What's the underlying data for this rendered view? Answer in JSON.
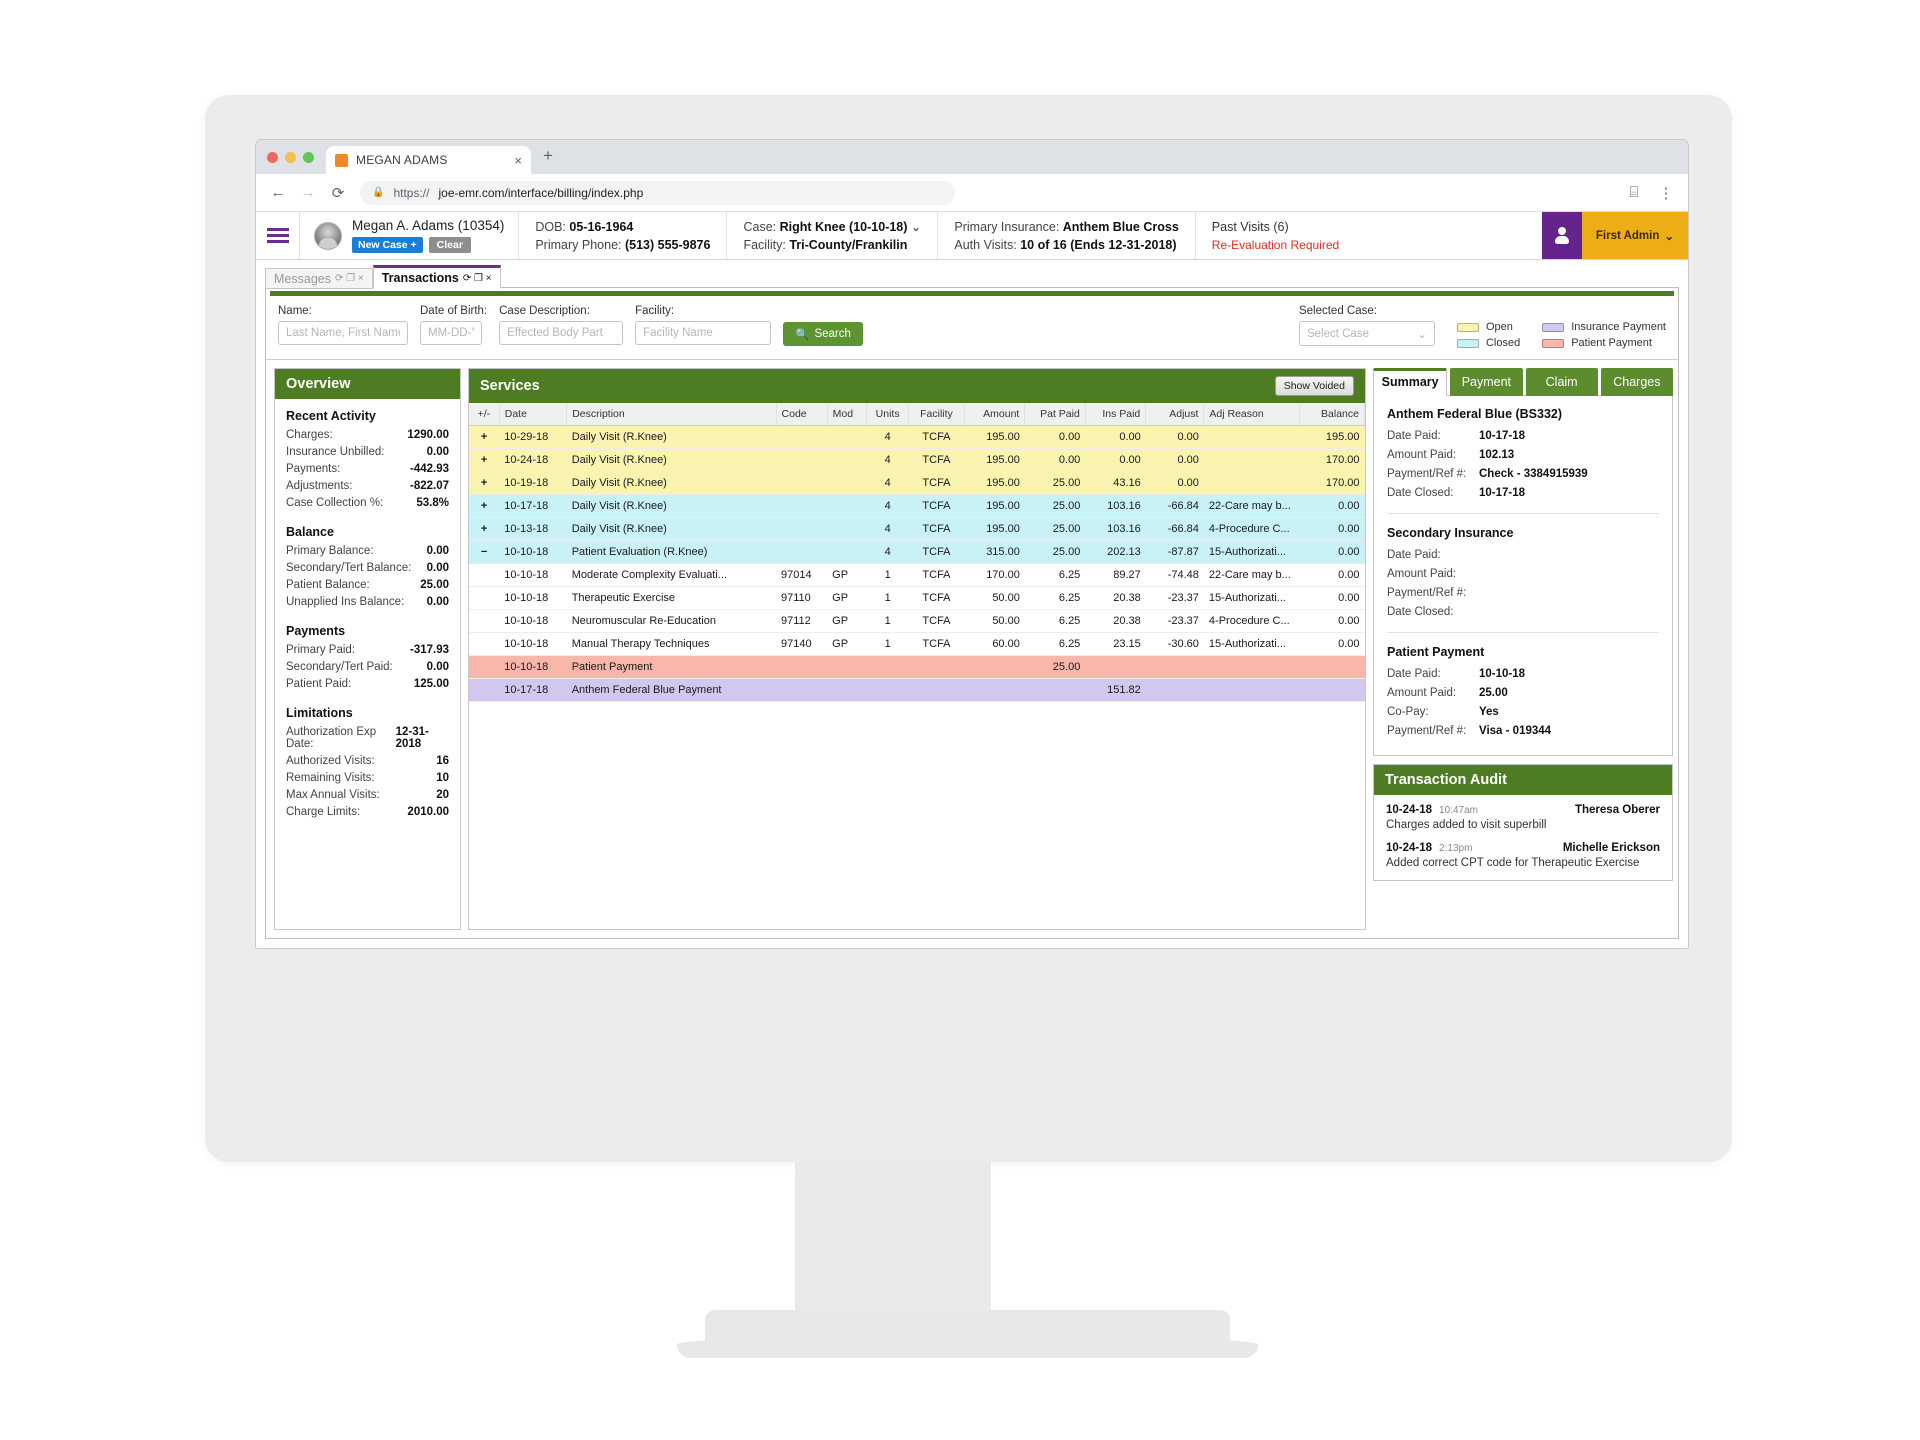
{
  "browser": {
    "tab_title": "MEGAN ADAMS",
    "close_label": "×",
    "newtab_label": "+",
    "back_icon": "←",
    "forward_icon": "→",
    "reload_icon": "⟳",
    "lock_icon": "🔒",
    "url_scheme": "https://",
    "url_rest": "joe-emr.com/interface/billing/index.php",
    "bookmark_icon": "⌸",
    "menu_icon": "⋮"
  },
  "patient_header": {
    "name": "Megan A. Adams (10354)",
    "new_case_label": "New Case +",
    "clear_label": "Clear",
    "dob_label": "DOB:",
    "dob_value": "05-16-1964",
    "phone_label": "Primary Phone:",
    "phone_value": "(513) 555-9876",
    "case_label": "Case:",
    "case_value": "Right Knee (10-10-18)",
    "case_caret": "⌄",
    "facility_label": "Facility:",
    "facility_value": "Tri-County/Frankilin",
    "primary_insurance_label": "Primary Insurance:",
    "primary_insurance_value": "Anthem Blue Cross",
    "auth_visits_label": "Auth Visits:",
    "auth_visits_value": "10 of 16 (Ends 12-31-2018)",
    "past_visits": "Past Visits (6)",
    "reevaluation": "Re-Evaluation Required",
    "admin_label": "First Admin",
    "admin_caret": "⌄",
    "accent_purple": "#65248b",
    "accent_gold": "#edad15"
  },
  "app_tabs": [
    {
      "label": "Messages",
      "active": false,
      "icons": "⟳ ❐ ×"
    },
    {
      "label": "Transactions",
      "active": true,
      "icons": "⟳ ❐ ×"
    }
  ],
  "search": {
    "name_label": "Name:",
    "name_placeholder": "Last Name, First Name",
    "dob_label": "Date of Birth:",
    "dob_placeholder": "MM-DD-YY",
    "case_label": "Case Description:",
    "case_placeholder": "Effected Body Part",
    "facility_label": "Facility:",
    "facility_placeholder": "Facility Name",
    "search_button": "Search",
    "search_icon": "🔍",
    "selected_case_label": "Selected Case:",
    "selected_case_value": "Select Case",
    "selected_case_caret": "⌄"
  },
  "legend": [
    {
      "label": "Open",
      "color": "#fbf3b0"
    },
    {
      "label": "Insurance Payment",
      "color": "#d2c8ef"
    },
    {
      "label": "Closed",
      "color": "#c9f2f7"
    },
    {
      "label": "Patient Payment",
      "color": "#f9b6ab"
    }
  ],
  "overview": {
    "title": "Overview",
    "sections": [
      {
        "heading": "Recent Activity",
        "rows": [
          {
            "k": "Charges:",
            "v": "1290.00"
          },
          {
            "k": "Insurance Unbilled:",
            "v": "0.00"
          },
          {
            "k": "Payments:",
            "v": "-442.93"
          },
          {
            "k": "Adjustments:",
            "v": "-822.07"
          },
          {
            "k": "Case Collection %:",
            "v": "53.8%"
          }
        ]
      },
      {
        "heading": "Balance",
        "rows": [
          {
            "k": "Primary Balance:",
            "v": "0.00"
          },
          {
            "k": "Secondary/Tert Balance:",
            "v": "0.00"
          },
          {
            "k": "Patient Balance:",
            "v": "25.00"
          },
          {
            "k": "Unapplied Ins Balance:",
            "v": "0.00"
          }
        ]
      },
      {
        "heading": "Payments",
        "rows": [
          {
            "k": "Primary Paid:",
            "v": "-317.93"
          },
          {
            "k": "Secondary/Tert Paid:",
            "v": "0.00"
          },
          {
            "k": "Patient Paid:",
            "v": "125.00"
          }
        ]
      },
      {
        "heading": "Limitations",
        "rows": [
          {
            "k": "Authorization Exp Date:",
            "v": "12-31-2018"
          },
          {
            "k": "Authorized Visits:",
            "v": "16"
          },
          {
            "k": "Remaining Visits:",
            "v": "10"
          },
          {
            "k": "Max Annual Visits:",
            "v": "20"
          },
          {
            "k": "Charge Limits:",
            "v": "2010.00"
          }
        ]
      }
    ]
  },
  "services": {
    "title": "Services",
    "show_voided_label": "Show Voided",
    "columns": [
      "+/-",
      "Date",
      "Description",
      "Code",
      "Mod",
      "Units",
      "Facility",
      "Amount",
      "Pat Paid",
      "Ins Paid",
      "Adjust",
      "Adj Reason",
      "Balance"
    ],
    "rows": [
      {
        "type": "open",
        "pm": "+",
        "date": "10-29-18",
        "desc": "Daily Visit (R.Knee)",
        "code": "",
        "mod": "",
        "units": "4",
        "facility": "TCFA",
        "amount": "195.00",
        "pat_paid": "0.00",
        "ins_paid": "0.00",
        "adjust": "0.00",
        "adj_reason": "",
        "balance": "195.00"
      },
      {
        "type": "open",
        "pm": "+",
        "date": "10-24-18",
        "desc": "Daily Visit (R.Knee)",
        "code": "",
        "mod": "",
        "units": "4",
        "facility": "TCFA",
        "amount": "195.00",
        "pat_paid": "0.00",
        "ins_paid": "0.00",
        "adjust": "0.00",
        "adj_reason": "",
        "balance": "170.00"
      },
      {
        "type": "open",
        "pm": "+",
        "date": "10-19-18",
        "desc": "Daily Visit (R.Knee)",
        "code": "",
        "mod": "",
        "units": "4",
        "facility": "TCFA",
        "amount": "195.00",
        "pat_paid": "25.00",
        "ins_paid": "43.16",
        "adjust": "0.00",
        "adj_reason": "",
        "balance": "170.00"
      },
      {
        "type": "closed",
        "pm": "+",
        "date": "10-17-18",
        "desc": "Daily Visit (R.Knee)",
        "code": "",
        "mod": "",
        "units": "4",
        "facility": "TCFA",
        "amount": "195.00",
        "pat_paid": "25.00",
        "ins_paid": "103.16",
        "adjust": "-66.84",
        "adj_reason": "22-Care may b...",
        "balance": "0.00"
      },
      {
        "type": "closed",
        "pm": "+",
        "date": "10-13-18",
        "desc": "Daily Visit (R.Knee)",
        "code": "",
        "mod": "",
        "units": "4",
        "facility": "TCFA",
        "amount": "195.00",
        "pat_paid": "25.00",
        "ins_paid": "103.16",
        "adjust": "-66.84",
        "adj_reason": "4-Procedure C...",
        "balance": "0.00"
      },
      {
        "type": "closed",
        "pm": "−",
        "date": "10-10-18",
        "desc": "Patient Evaluation (R.Knee)",
        "code": "",
        "mod": "",
        "units": "4",
        "facility": "TCFA",
        "amount": "315.00",
        "pat_paid": "25.00",
        "ins_paid": "202.13",
        "adjust": "-87.87",
        "adj_reason": "15-Authorizati...",
        "balance": "0.00"
      },
      {
        "type": "plain",
        "pm": "",
        "date": "10-10-18",
        "desc": "Moderate Complexity Evaluati...",
        "code": "97014",
        "mod": "GP",
        "units": "1",
        "facility": "TCFA",
        "amount": "170.00",
        "pat_paid": "6.25",
        "ins_paid": "89.27",
        "adjust": "-74.48",
        "adj_reason": "22-Care may b...",
        "balance": "0.00"
      },
      {
        "type": "plain",
        "pm": "",
        "date": "10-10-18",
        "desc": "Therapeutic Exercise",
        "code": "97110",
        "mod": "GP",
        "units": "1",
        "facility": "TCFA",
        "amount": "50.00",
        "pat_paid": "6.25",
        "ins_paid": "20.38",
        "adjust": "-23.37",
        "adj_reason": "15-Authorizati...",
        "balance": "0.00"
      },
      {
        "type": "plain",
        "pm": "",
        "date": "10-10-18",
        "desc": "Neuromuscular Re-Education",
        "code": "97112",
        "mod": "GP",
        "units": "1",
        "facility": "TCFA",
        "amount": "50.00",
        "pat_paid": "6.25",
        "ins_paid": "20.38",
        "adjust": "-23.37",
        "adj_reason": "4-Procedure C...",
        "balance": "0.00"
      },
      {
        "type": "plain",
        "pm": "",
        "date": "10-10-18",
        "desc": "Manual Therapy Techniques",
        "code": "97140",
        "mod": "GP",
        "units": "1",
        "facility": "TCFA",
        "amount": "60.00",
        "pat_paid": "6.25",
        "ins_paid": "23.15",
        "adjust": "-30.60",
        "adj_reason": "15-Authorizati...",
        "balance": "0.00"
      },
      {
        "type": "pat",
        "pm": "",
        "date": "10-10-18",
        "desc": "Patient Payment",
        "code": "",
        "mod": "",
        "units": "",
        "facility": "",
        "amount": "",
        "pat_paid": "25.00",
        "ins_paid": "",
        "adjust": "",
        "adj_reason": "",
        "balance": ""
      },
      {
        "type": "ins",
        "pm": "",
        "date": "10-17-18",
        "desc": "Anthem Federal Blue Payment",
        "code": "",
        "mod": "",
        "units": "",
        "facility": "",
        "amount": "",
        "pat_paid": "",
        "ins_paid": "151.82",
        "adjust": "",
        "adj_reason": "",
        "balance": ""
      }
    ]
  },
  "right_panel": {
    "tabs": [
      {
        "label": "Summary",
        "active": true
      },
      {
        "label": "Payment",
        "active": false
      },
      {
        "label": "Claim",
        "active": false
      },
      {
        "label": "Charges",
        "active": false
      }
    ],
    "blocks": [
      {
        "heading": "Anthem Federal Blue (BS332)",
        "rows": [
          {
            "k": "Date Paid:",
            "v": "10-17-18"
          },
          {
            "k": "Amount Paid:",
            "v": "102.13"
          },
          {
            "k": "Payment/Ref #:",
            "v": "Check - 3384915939"
          },
          {
            "k": "Date Closed:",
            "v": "10-17-18"
          }
        ]
      },
      {
        "heading": "Secondary Insurance",
        "rows": [
          {
            "k": "Date Paid:",
            "v": ""
          },
          {
            "k": "Amount Paid:",
            "v": ""
          },
          {
            "k": "Payment/Ref #:",
            "v": ""
          },
          {
            "k": "Date Closed:",
            "v": ""
          }
        ]
      },
      {
        "heading": "Patient Payment",
        "rows": [
          {
            "k": "Date Paid:",
            "v": "10-10-18"
          },
          {
            "k": "Amount Paid:",
            "v": "25.00"
          },
          {
            "k": "Co-Pay:",
            "v": "Yes"
          },
          {
            "k": "Payment/Ref #:",
            "v": "Visa - 019344"
          }
        ]
      }
    ],
    "audit": {
      "title": "Transaction Audit",
      "entries": [
        {
          "date": "10-24-18",
          "time": "10:47am",
          "user": "Theresa Oberer",
          "text": "Charges added to visit superbill"
        },
        {
          "date": "10-24-18",
          "time": "2:13pm",
          "user": "Michelle Erickson",
          "text": "Added correct CPT code for Therapeutic Exercise"
        }
      ]
    }
  }
}
